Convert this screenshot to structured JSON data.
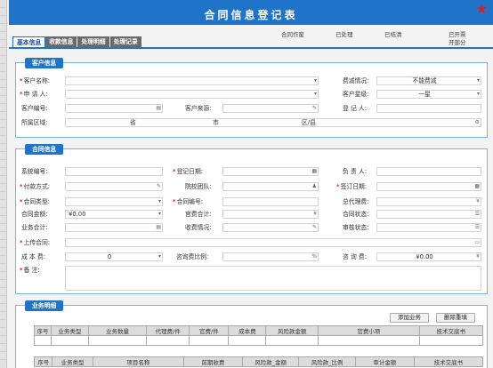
{
  "window": {
    "title": "合同信息登记表"
  },
  "status_bar": {
    "s1": "合同作废",
    "s2": "已处理",
    "s3": "已结清",
    "s4a": "已开票",
    "s4b": "开部分"
  },
  "tabs": [
    "基本信息",
    "收款信息",
    "处理明细",
    "处理记录"
  ],
  "customer": {
    "header": "客户信息",
    "name_label": "客户名称:",
    "fee_label": "费减情况:",
    "fee_value": "不能费减",
    "applicant_label": "申 请 人:",
    "star_label": "客户星级:",
    "star_value": "一星",
    "code_label": "客户编号:",
    "source_label": "客户来源:",
    "registrar_label": "登 记 人:",
    "region_label": "所属区域:",
    "province": "省",
    "city": "市",
    "district": "区/县"
  },
  "contract": {
    "header": "合同信息",
    "sys_no_label": "系统编号:",
    "reg_date_label": "登记日期:",
    "owner_label": "负 责 人:",
    "pay_method_label": "付款方式:",
    "school_team_label": "院校团队:",
    "sign_date_label": "签订日期:",
    "type_label": "合同类型:",
    "contract_no_label": "合同编号:",
    "agent_fee_label": "总代理费:",
    "amount_label": "合同金额:",
    "amount_value": "¥0.00",
    "official_fee_label": "官费合计:",
    "status_label": "合同状态:",
    "biz_total_label": "业务合计:",
    "receipt_label": "收费情况:",
    "audit_label": "审核状态:",
    "upload_label": "上传合同:",
    "cost_label": "成 本 费:",
    "cost_value": "0",
    "consult_ratio_label": "咨询费比例:",
    "ratio_unit": "%",
    "consult_label": "咨 询 费:",
    "consult_value": "¥0.00",
    "note_label": "备    注:"
  },
  "business": {
    "header": "业务明细",
    "add_button": "添加业务",
    "reset_button": "删除重填",
    "table1_headers": [
      "序号",
      "业务类型",
      "业务数量",
      "代理费/件",
      "官费/件",
      "成本费",
      "风险款金额",
      "官费小项",
      "技术交底书"
    ],
    "table2_headers": [
      "序号",
      "业务类型",
      "项目名称",
      "前期收费",
      "风险款_金额",
      "风险款_比例",
      "审计金额",
      "技术交底书"
    ]
  },
  "colors": {
    "accent": "#1f73c9",
    "required": "#e02020",
    "star": "#e21b1b"
  }
}
